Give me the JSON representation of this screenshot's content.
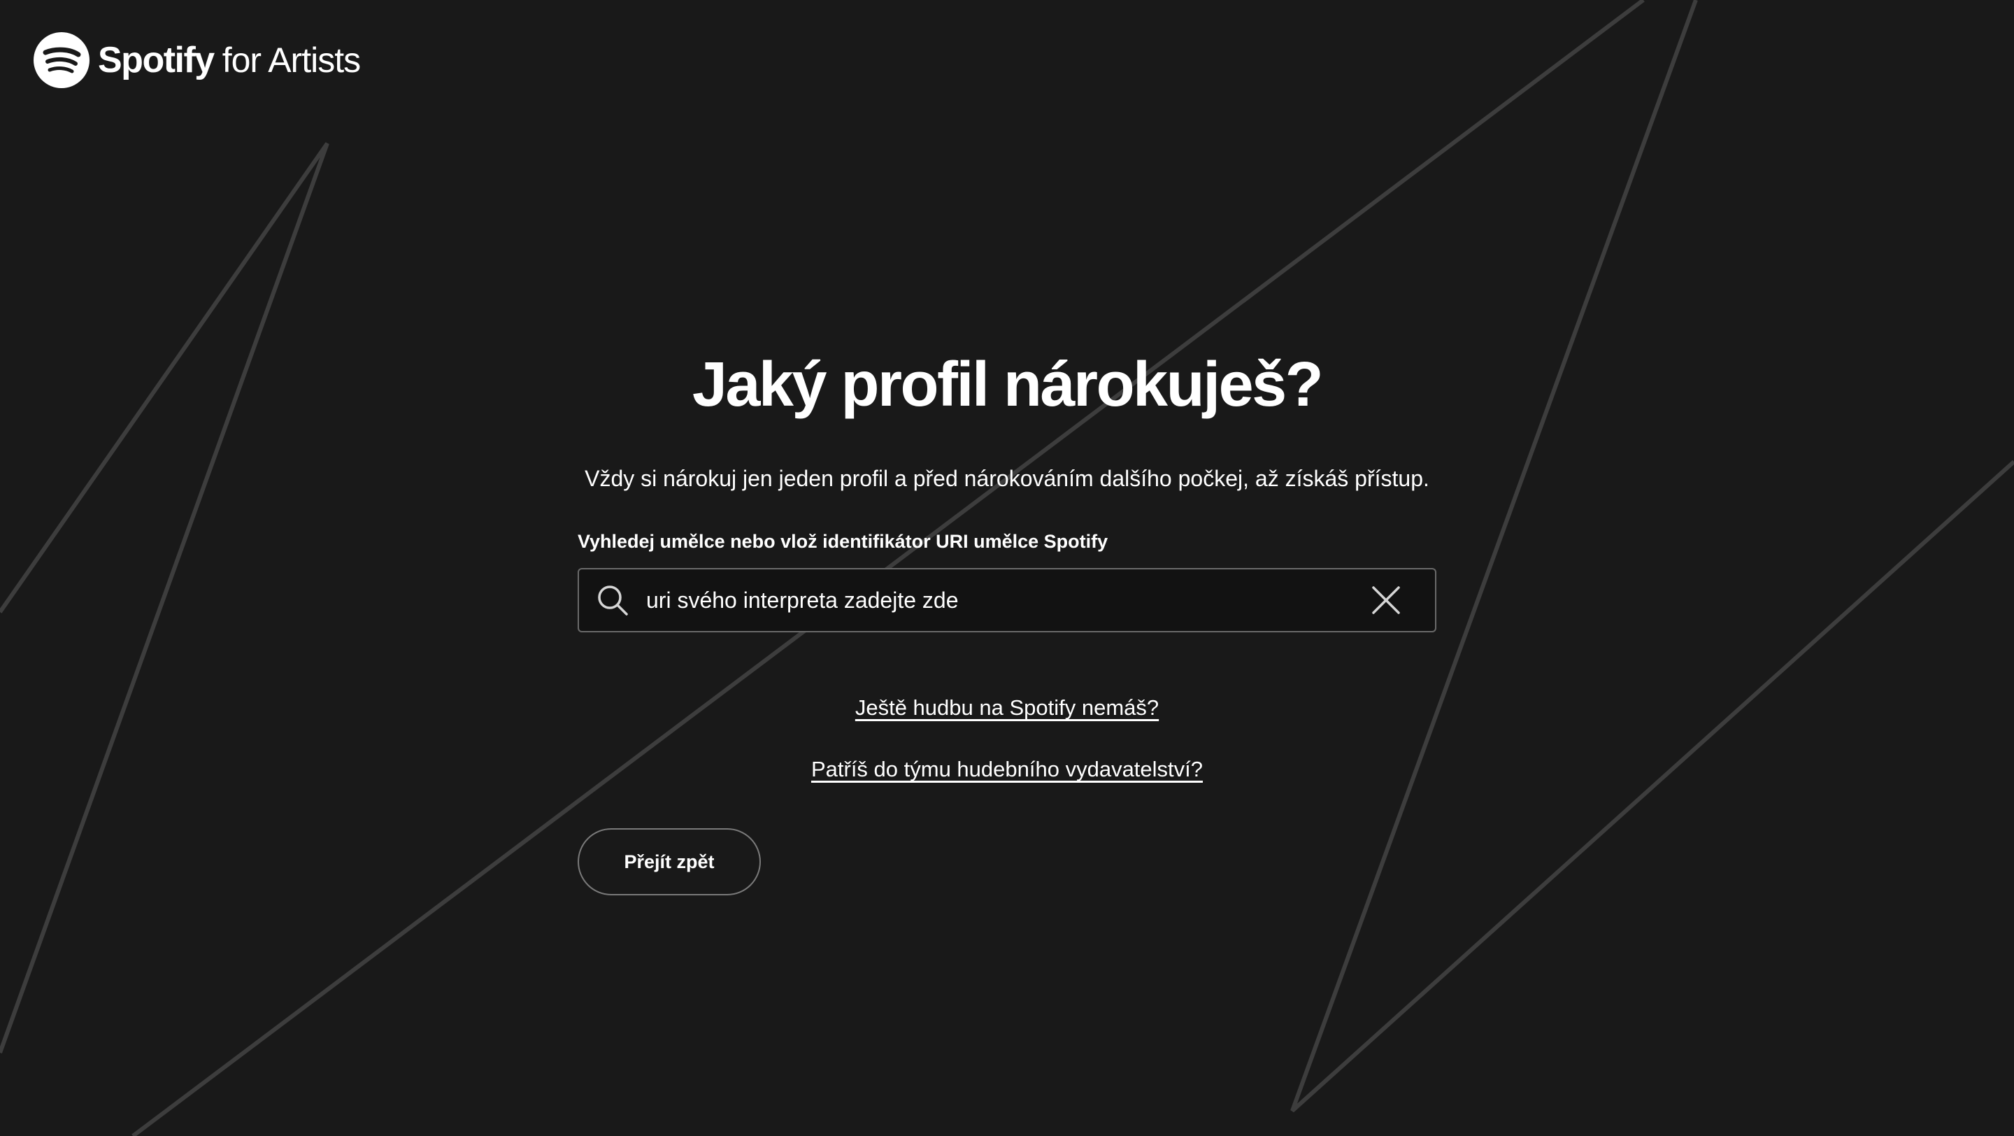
{
  "brand": {
    "name": "Spotify",
    "suffix": "for Artists",
    "logo_icon": "spotify-logo-icon"
  },
  "title": "Jaký profil nárokuješ?",
  "subtitle": "Vždy si nárokuj jen jeden profil a před nárokováním dalšího počkej, až získáš přístup.",
  "search": {
    "label": "Vyhledej umělce nebo vlož identifikátor URI umělce Spotify",
    "value": "uri svého interpreta zadejte zde",
    "search_icon": "search-icon",
    "clear_icon": "close-icon"
  },
  "links": {
    "no_music": "Ještě hudbu na Spotify nemáš?",
    "label_team": "Patříš do týmu hudebního vydavatelství?"
  },
  "back_button": "Přejít zpět",
  "colors": {
    "background": "#191919",
    "text": "#ffffff",
    "border": "#6a6a6a",
    "decor_lines": "#3d3d3d"
  }
}
